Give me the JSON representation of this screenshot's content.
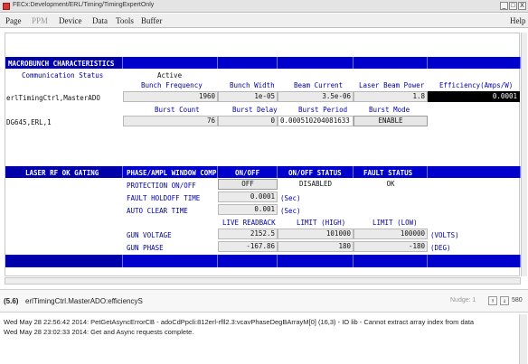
{
  "window": {
    "title": "FECx:Development/ERL/Timing/TimingExpertOnly",
    "minimize": "_",
    "maximize": "□",
    "close": "X"
  },
  "menu": {
    "page": "Page",
    "ppm": "PPM",
    "device": "Device",
    "data": "Data",
    "tools": "Tools",
    "buffer": "Buffer",
    "help": "Help"
  },
  "macrobunch": {
    "header": "MACROBUNCH CHARACTERISTICS",
    "comm_status_label": "Communication Status",
    "comm_status_value": "Active",
    "col_bunch_frequency": "Bunch Frequency",
    "col_bunch_width": "Bunch Width",
    "col_beam_current": "Beam Current",
    "col_laser_beam_power": "Laser Beam Power",
    "col_efficiency": "Efficiency(Amps/W)",
    "row1_device": "erlTimingCtrl,MasterADO",
    "bunch_frequency": "1960",
    "bunch_width": "1e-05",
    "beam_current": "3.5e-06",
    "laser_beam_power": "1.8",
    "efficiency": "0.0001",
    "col_burst_count": "Burst Count",
    "col_burst_delay": "Burst Delay",
    "col_burst_period": "Burst Period",
    "col_burst_mode": "Burst Mode",
    "row2_device": "DG645,ERL,1",
    "burst_count": "76",
    "burst_delay": "0",
    "burst_period": "0.000510204081633",
    "burst_mode": "ENABLE"
  },
  "gating": {
    "label": "LASER RF OK GATING",
    "col_phase_amp": "PHASE/AMPL WINDOW COMP",
    "col_onoff": "ON/OFF",
    "col_onoff_status": "ON/OFF STATUS",
    "col_fault_status": "FAULT STATUS",
    "protection_label": "PROTECTION ON/OFF",
    "protection_value": "OFF",
    "protection_status": "DISABLED",
    "protection_fault": "OK",
    "fault_holdoff_label": "FAULT HOLDOFF TIME",
    "fault_holdoff_value": "0.0001",
    "fault_holdoff_unit": "(Sec)",
    "auto_clear_label": "AUTO CLEAR TIME",
    "auto_clear_value": "0.001",
    "auto_clear_unit": "(Sec)",
    "col_live_readback": "LIVE READBACK",
    "col_limit_high": "LIMIT (HIGH)",
    "col_limit_low": "LIMIT (LOW)",
    "gun_voltage_label": "GUN VOLTAGE",
    "gun_voltage_live": "2152.5",
    "gun_voltage_high": "101000",
    "gun_voltage_low": "100000",
    "gun_voltage_unit": "(VOLTS)",
    "gun_phase_label": "GUN PHASE",
    "gun_phase_live": "-167.86",
    "gun_phase_high": "180",
    "gun_phase_low": "-180",
    "gun_phase_unit": "(DEG)"
  },
  "status": {
    "marker": "(5.6)",
    "device_path": "erlTimingCtrl.MasterADO:efficiencyS",
    "nudge_label": "Nudge: 1",
    "nudge_up": "↑",
    "nudge_down": "↓",
    "zoom": "580"
  },
  "log": {
    "line1": "Wed May 28 22:56:42 2014: PetGetAsyncErrorCB - adoCdPpcli:812erl-rfll2.3:vcavPhaseDegBArrayM[0] (16,3) - IO lib - Cannot extract array index from data",
    "line2": "Wed May 28 23:02:33 2014: Get and Async requests complete."
  }
}
